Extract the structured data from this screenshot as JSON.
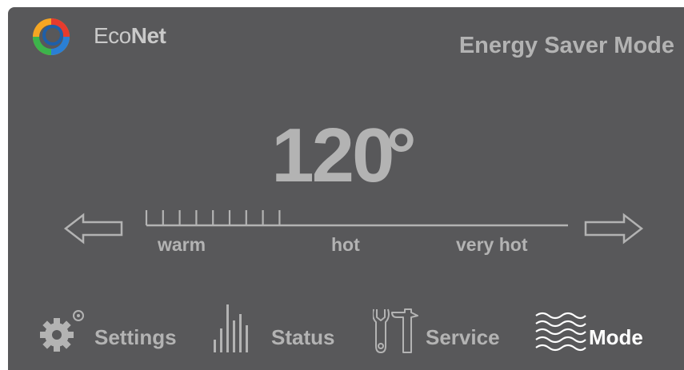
{
  "header": {
    "brand_prefix": "Eco",
    "brand_suffix": "Net",
    "mode_title": "Energy Saver Mode"
  },
  "temperature": {
    "value": "120",
    "unit": "°"
  },
  "slider": {
    "labels": [
      "warm",
      "hot",
      "very hot"
    ],
    "filled_ticks": 9,
    "level_fraction": 0.32
  },
  "nav": {
    "settings": {
      "label": "Settings",
      "icon": "gears-icon"
    },
    "status": {
      "label": "Status",
      "icon": "bar-graph-icon"
    },
    "service": {
      "label": "Service",
      "icon": "wrench-hammer-icon"
    },
    "mode": {
      "label": "Mode",
      "icon": "waves-icon",
      "active": true
    }
  },
  "colors": {
    "background": "#58585a",
    "text_muted": "#b3b3b3",
    "active": "#ffffff"
  }
}
